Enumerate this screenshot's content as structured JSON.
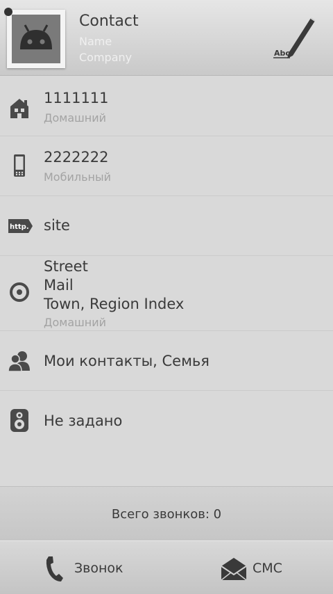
{
  "header": {
    "title": "Contact",
    "name_hint": "Name",
    "company_hint": "Company",
    "edit_icon_text": "Abc"
  },
  "rows": {
    "home_phone": {
      "value": "1111111",
      "label": "Домашний"
    },
    "mobile_phone": {
      "value": "2222222",
      "label": "Мобильный"
    },
    "website": {
      "icon_text": "http.",
      "value": "site"
    },
    "address": {
      "line1": "Street",
      "line2": "Mail",
      "line3": "Town, Region Index",
      "label": "Домашний"
    },
    "groups": {
      "value": "Мои контакты, Семья"
    },
    "ringtone": {
      "value": "Не задано"
    }
  },
  "calls": {
    "summary": "Всего звонков: 0"
  },
  "actions": {
    "call_label": "Звонок",
    "sms_label": "СМС"
  },
  "colors": {
    "background": "#d9d9d9",
    "icon": "#4a4a4a",
    "text": "#3a3a3a",
    "secondary": "#a3a3a3"
  }
}
